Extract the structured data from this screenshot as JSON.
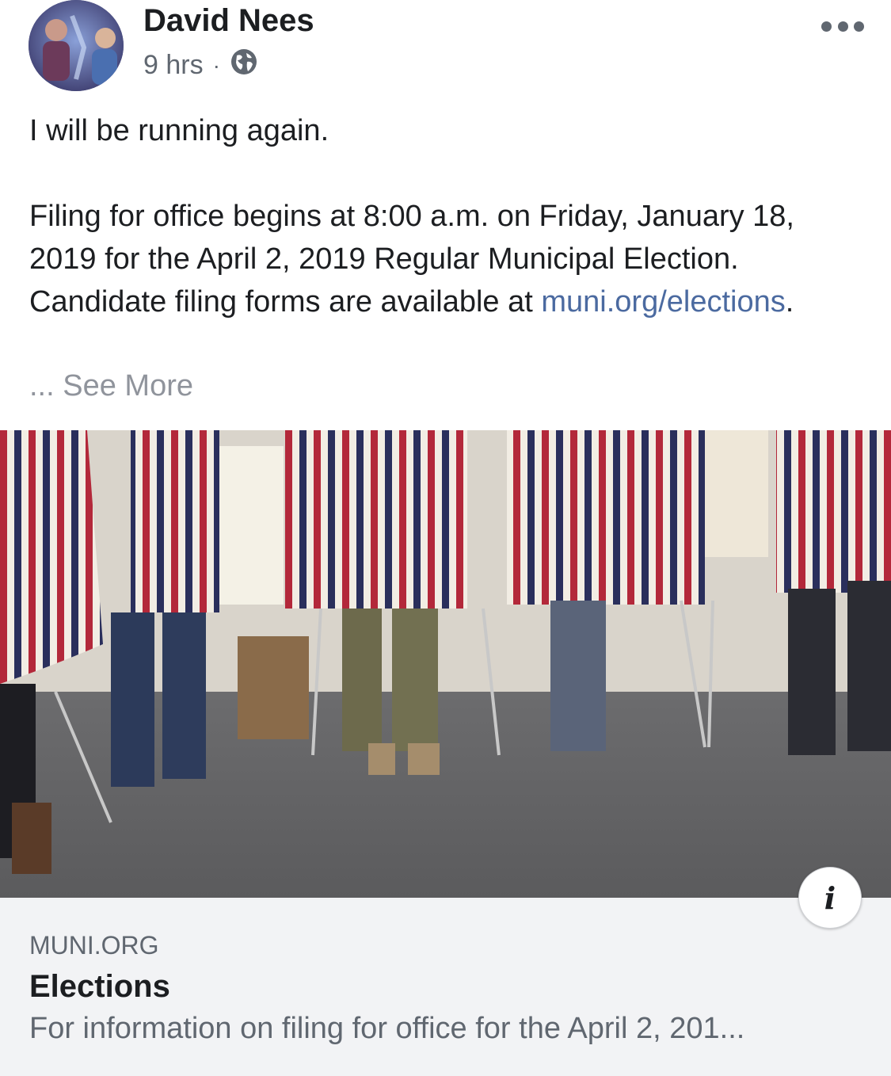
{
  "post": {
    "author": "David Nees",
    "time": "9 hrs",
    "separator": "·",
    "privacy_icon": "globe-icon",
    "paragraph1": "I will be running again.",
    "paragraph2": "Filing for office begins at 8:00 a.m. on Friday, January 18, 2019 for the April 2, 2019 Regular Municipal Election. Candidate filing forms are available at",
    "link_text": "muni.org/elections",
    "link_suffix": ".",
    "ellipsis": "...",
    "see_more": "See More"
  },
  "link_card": {
    "domain": "MUNI.ORG",
    "title": "Elections",
    "description": "For information on filing for office for the April 2, 201...",
    "info_label": "i",
    "background": "#f2f3f5"
  },
  "colors": {
    "link": "#4b6aa0",
    "secondary_text": "#606770",
    "stripe_red": "#b3283a",
    "stripe_navy": "#2a2f5c"
  }
}
